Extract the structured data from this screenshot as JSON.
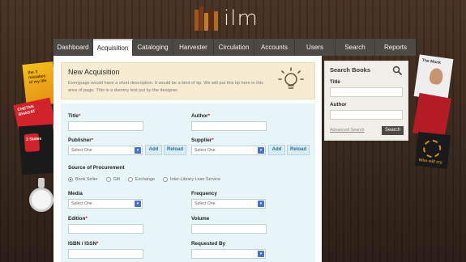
{
  "brand": {
    "logo_text": "ilm"
  },
  "nav": {
    "items": [
      {
        "label": "Dashboard",
        "active": false
      },
      {
        "label": "Acquisition",
        "active": true
      },
      {
        "label": "Cataloging",
        "active": false
      },
      {
        "label": "Harvester",
        "active": false
      },
      {
        "label": "Circulation",
        "active": false
      },
      {
        "label": "Accounts",
        "active": false
      },
      {
        "label": "Users",
        "active": false
      },
      {
        "label": "Search",
        "active": false
      },
      {
        "label": "Reports",
        "active": false
      }
    ]
  },
  "tip": {
    "title": "New Acquisition",
    "description": "Everypage would have a short description. It would be a kind of tip. We will put this tip here in this area of page. This is a dummy text put by the designer."
  },
  "form": {
    "title_label": "Title",
    "author_label": "Author",
    "publisher_label": "Publisher",
    "publisher_value": "Select One",
    "supplier_label": "Supplier",
    "supplier_value": "Select One",
    "add_label": "Add",
    "reload_label": "Reload",
    "source_label": "Source of Procurement",
    "source_options": [
      "Book Seller",
      "Gift",
      "Exchange",
      "Inter-Library Loan Service"
    ],
    "source_selected": "Book Seller",
    "media_label": "Media",
    "media_value": "Select One",
    "frequency_label": "Frequency",
    "frequency_value": "Select One",
    "edition_label": "Edition",
    "volume_label": "Volume",
    "isbn_label": "ISBN / ISSN",
    "requested_by_label": "Requested By",
    "required_mark": "*"
  },
  "side": {
    "title": "Search Books",
    "title_field_label": "Title",
    "author_field_label": "Author",
    "advanced_label": "Advanced Search",
    "search_button": "Search"
  },
  "decor": {
    "left_book_text": "the 3 mistakes of my life",
    "left_book2_text": "CHETAN BHAGAT",
    "left_book3_text": "2 States",
    "right_book_text": "The Monk",
    "right_book3_text": "Who will cry"
  },
  "colors": {
    "accent_required": "#d0202a",
    "nav_bg": "#4d4a46",
    "form_bg": "#e7f4f8",
    "tip_bg": "#f6ecd2"
  }
}
